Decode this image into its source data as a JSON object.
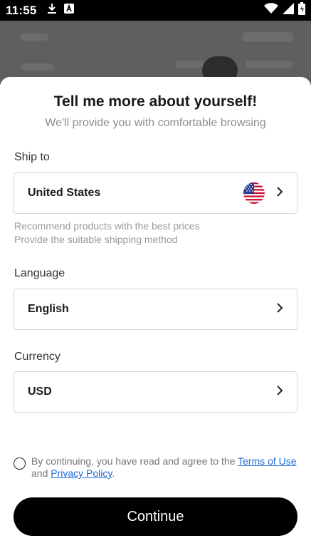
{
  "status_bar": {
    "time": "11:55"
  },
  "sheet": {
    "title": "Tell me more about yourself!",
    "subtitle": "We'll provide you with comfortable browsing"
  },
  "ship_to": {
    "label": "Ship to",
    "value": "United States",
    "flag_icon": "us-flag-icon",
    "hints": [
      "Recommend products with the best prices",
      "Provide the suitable shipping method"
    ]
  },
  "language": {
    "label": "Language",
    "value": "English"
  },
  "currency": {
    "label": "Currency",
    "value": "USD"
  },
  "agreement": {
    "prefix": "By continuing, you have read and agree to the ",
    "terms_link": "Terms of Use",
    "and_text": " and ",
    "privacy_link": "Privacy Policy",
    "suffix": "."
  },
  "continue_label": "Continue",
  "colors": {
    "link": "#1f6bd8",
    "button_bg": "#000000",
    "hint_text": "#9a9a9a"
  }
}
